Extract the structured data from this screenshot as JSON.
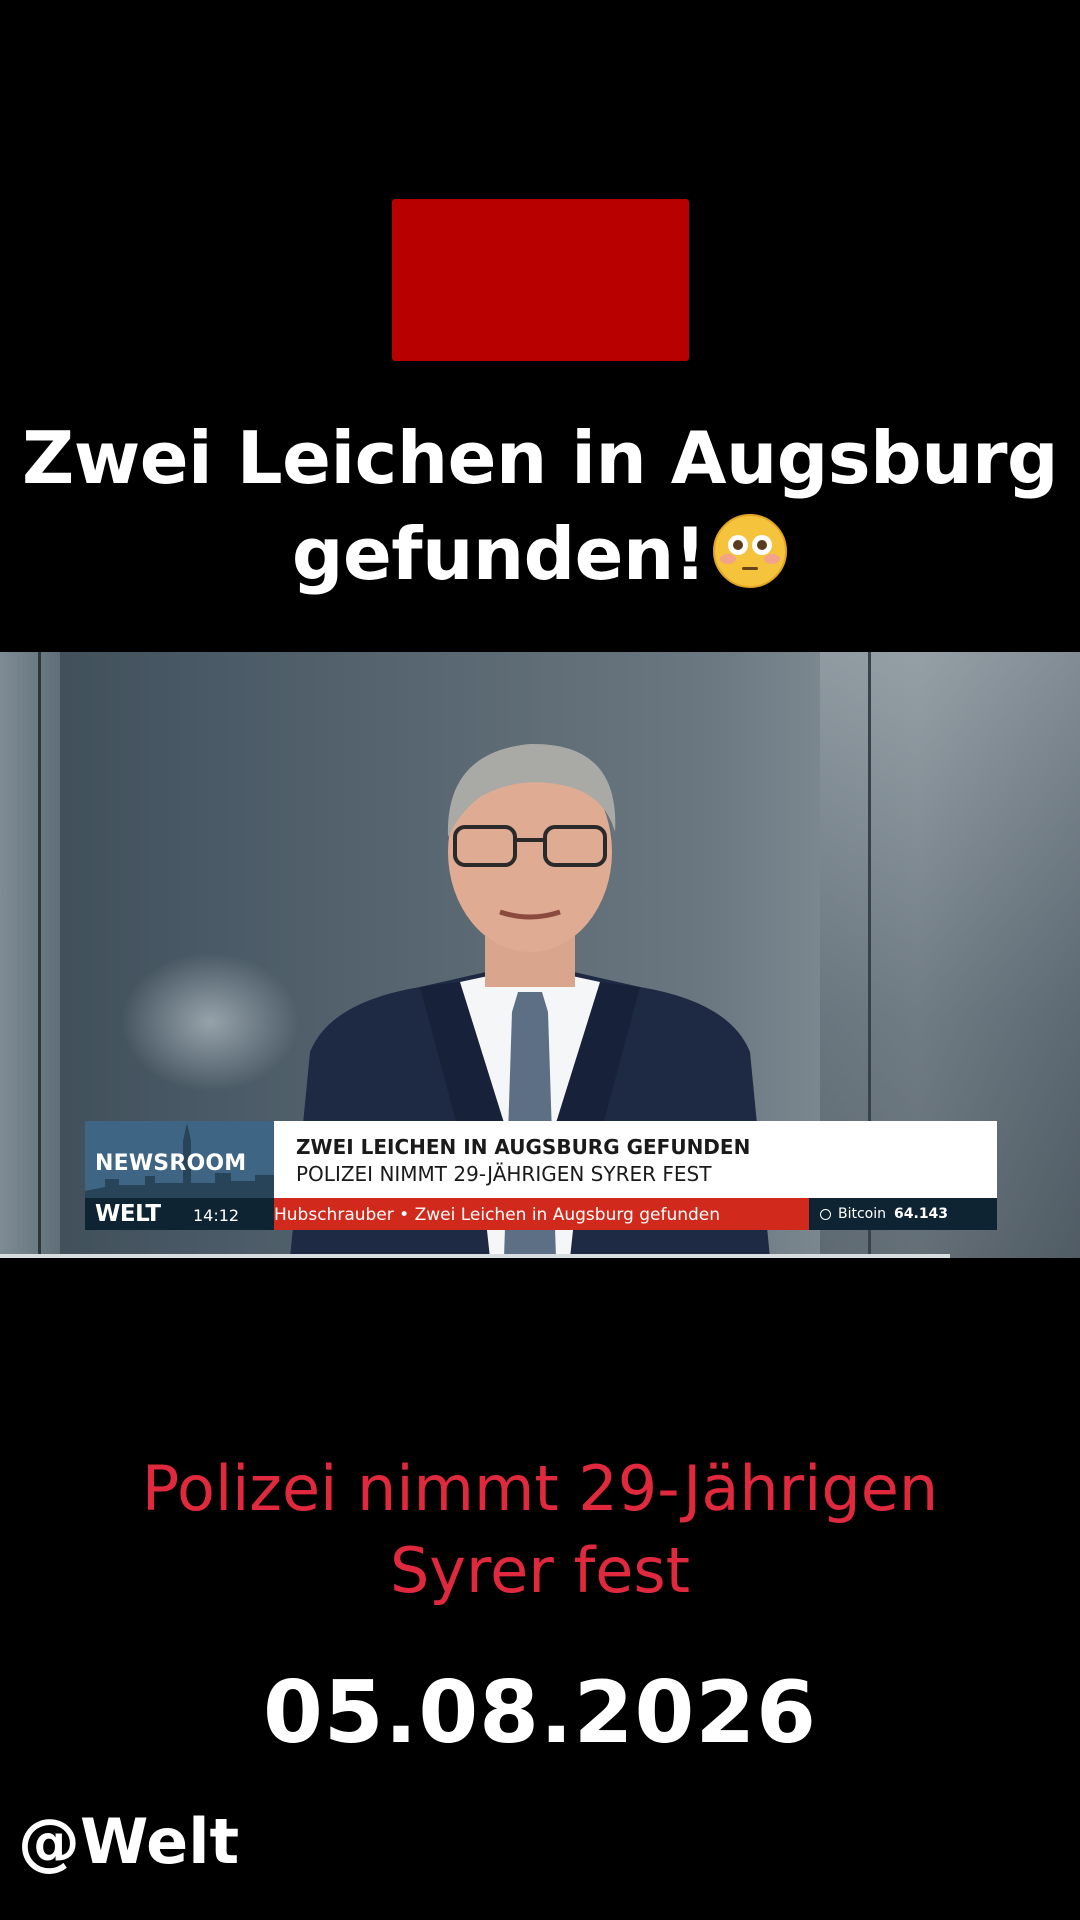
{
  "headline": {
    "line1": "Zwei Leichen in Augsburg",
    "line2": "gefunden!"
  },
  "headline_emoji": "flushed-face-emoji",
  "lower_third": {
    "brand_box": "NEWSROOM",
    "title": "ZWEI LEICHEN IN AUGSBURG GEFUNDEN",
    "subtitle": "POLIZEI NIMMT 29-JÄHRIGEN SYRER FEST",
    "channel": "WELT",
    "time": "14:12",
    "ticker": "Hubschrauber  • Zwei Leichen in Augsburg gefunden",
    "bitcoin_label": "Bitcoin",
    "bitcoin_value": "64.143"
  },
  "subline": {
    "line1": "Polizei nimmt 29-Jährigen",
    "line2": "Syrer fest"
  },
  "date": "05.08.2026",
  "handle": "@Welt",
  "colors": {
    "red_block": "#b80000",
    "subline": "#e0293c",
    "ticker": "#d12a1c",
    "lower_third_bar": "#0f2433"
  }
}
